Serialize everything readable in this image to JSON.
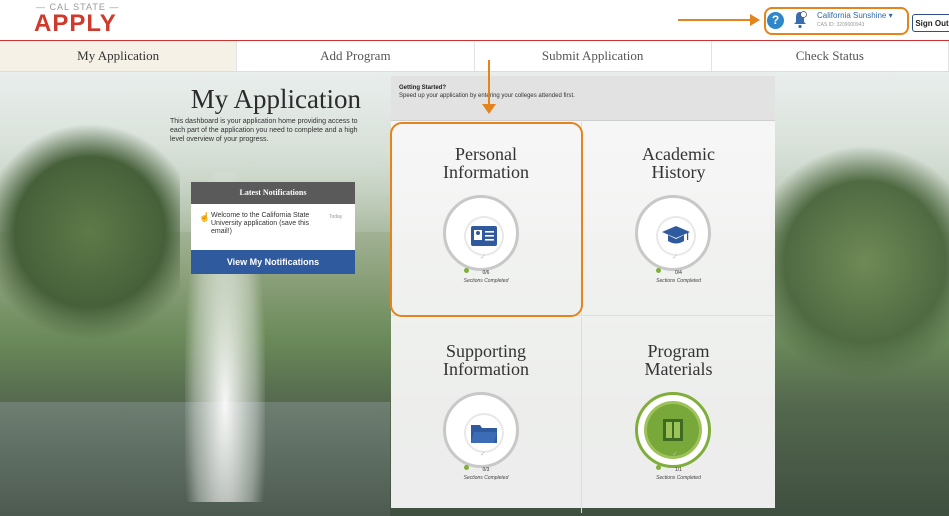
{
  "header": {
    "logo_top": "— CAL STATE —",
    "logo_main": "APPLY",
    "user_name": "California Sunshine",
    "user_id": "CAS ID: 3209000943",
    "sign_out": "Sign Out",
    "help_glyph": "?"
  },
  "nav": {
    "tabs": [
      {
        "label": "My Application"
      },
      {
        "label": "Add Program"
      },
      {
        "label": "Submit Application"
      },
      {
        "label": "Check Status"
      }
    ]
  },
  "intro": {
    "title": "My Application",
    "description": "This dashboard is your application home providing access to each part of the application you need to complete and a high level overview of your progress."
  },
  "notifications": {
    "heading": "Latest Notifications",
    "item_text": "Welcome to the California State University application (save this email!)",
    "item_date": "Today",
    "button": "View My Notifications"
  },
  "getting_started": {
    "title": "Getting Started?",
    "text": "Speed up your application by entering your colleges attended first."
  },
  "sections": [
    {
      "title_line1": "Personal",
      "title_line2": "Information",
      "count": "0/6",
      "label": "Sections Completed",
      "icon": "id-card-icon"
    },
    {
      "title_line1": "Academic",
      "title_line2": "History",
      "count": "0/4",
      "label": "Sections Completed",
      "icon": "graduation-cap-icon"
    },
    {
      "title_line1": "Supporting",
      "title_line2": "Information",
      "count": "0/3",
      "label": "Sections Completed",
      "icon": "folder-icon"
    },
    {
      "title_line1": "Program",
      "title_line2": "Materials",
      "count": "1/1",
      "label": "Sections Completed",
      "icon": "book-icon"
    }
  ],
  "colors": {
    "accent_orange": "#e5831c",
    "brand_red": "#cf3a2c",
    "button_blue": "#2f5a9e",
    "complete_green": "#78a83a"
  }
}
